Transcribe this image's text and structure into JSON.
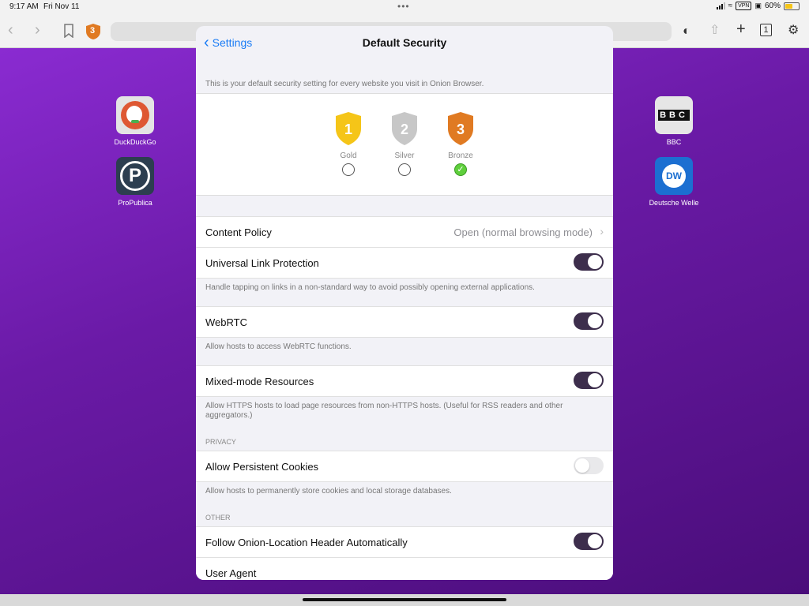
{
  "status": {
    "time": "9:17 AM",
    "date": "Fri Nov 11",
    "vpn": "VPN",
    "battery": "60%"
  },
  "toolbar": {
    "tabs_count": "1",
    "security_level": "3"
  },
  "home": {
    "apps": [
      {
        "label": "DuckDuckGo"
      },
      {
        "label": "ProPublica"
      },
      {
        "label": "BBC",
        "icon_text": "BBC"
      },
      {
        "label": "Deutsche Welle",
        "icon_text": "DW"
      }
    ]
  },
  "modal": {
    "back_label": "Settings",
    "title": "Default Security",
    "intro": "This is your default security setting for every website you visit in Onion Browser.",
    "levels": [
      {
        "number": "1",
        "name": "Gold",
        "color": "#f5c518",
        "selected": false
      },
      {
        "number": "2",
        "name": "Silver",
        "color": "#c7c7c7",
        "selected": false
      },
      {
        "number": "3",
        "name": "Bronze",
        "color": "#e07a22",
        "selected": true
      }
    ],
    "content_policy": {
      "label": "Content Policy",
      "value": "Open (normal browsing mode)"
    },
    "universal_link": {
      "label": "Universal Link Protection",
      "note": "Handle tapping on links in a non-standard way to avoid possibly opening external applications.",
      "on": true
    },
    "webrtc": {
      "label": "WebRTC",
      "note": "Allow hosts to access WebRTC functions.",
      "on": true
    },
    "mixed_mode": {
      "label": "Mixed-mode Resources",
      "note": "Allow HTTPS hosts to load page resources from non-HTTPS hosts. (Useful for RSS readers and other aggregators.)",
      "on": true
    },
    "privacy_header": "PRIVACY",
    "cookies": {
      "label": "Allow Persistent Cookies",
      "note": "Allow hosts to permanently store cookies and local storage databases.",
      "on": false
    },
    "other_header": "OTHER",
    "onion_location": {
      "label": "Follow Onion-Location Header Automatically",
      "on": true
    },
    "user_agent": {
      "label": "User Agent"
    }
  },
  "colors": {
    "accent": "#1a7cf5",
    "toggle_on": "#3d2e4c",
    "background_purple": "#6a1aa6"
  }
}
